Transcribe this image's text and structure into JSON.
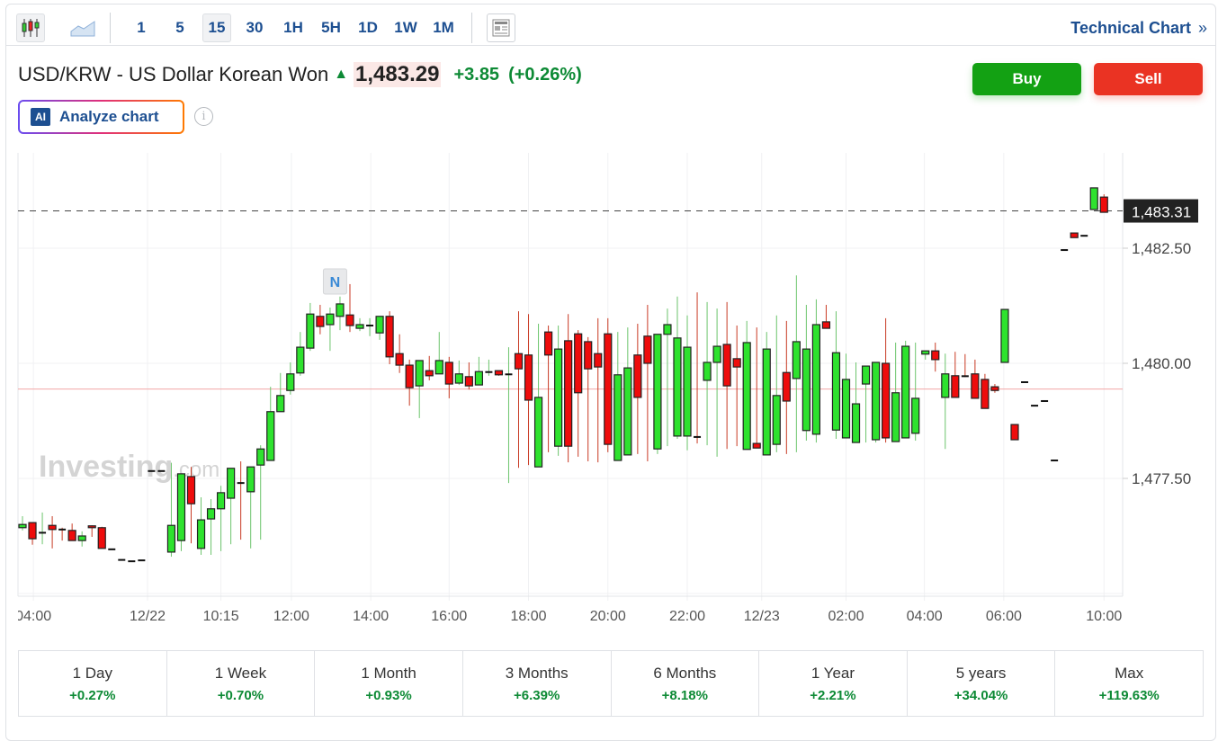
{
  "toolbar": {
    "intervals": [
      "1",
      "5",
      "15",
      "30",
      "1H",
      "5H",
      "1D",
      "1W",
      "1M"
    ],
    "active_interval": "15",
    "technical_chart": "Technical Chart",
    "technical_chart_icon": "double-chevron-right-icon"
  },
  "header": {
    "title": "USD/KRW - US Dollar Korean Won",
    "price": "1,483.29",
    "change": "+3.85",
    "change_pct": "(+0.26%)",
    "direction": "up"
  },
  "actions": {
    "buy": "Buy",
    "sell": "Sell",
    "analyze": "Analyze chart",
    "ai_badge": "AI"
  },
  "colors": {
    "up": "#2ee22e",
    "down": "#ee0c0c",
    "buy": "#13a113",
    "sell": "#ea3323",
    "link": "#1d4f91",
    "positive": "#0d8a35"
  },
  "watermark": {
    "brand": "Investing",
    "suffix": ".com"
  },
  "chart_data": {
    "type": "candlestick",
    "current_price_label": "1,483.31",
    "current_price": 1483.31,
    "reference_line": 1479.44,
    "ylim": [
      1474.96,
      1484.57
    ],
    "yticks": [
      {
        "v": 1482.5,
        "label": "1,482.50"
      },
      {
        "v": 1480.0,
        "label": "1,480.00"
      },
      {
        "v": 1477.5,
        "label": "1,477.50"
      }
    ],
    "ygrid": [
      1475,
      1477.5,
      1480,
      1482.5
    ],
    "xticks": [
      {
        "i": 1.1,
        "label": "04:00"
      },
      {
        "i": 12.6,
        "label": "12/22"
      },
      {
        "i": 20.0,
        "label": "10:15"
      },
      {
        "i": 27.1,
        "label": "12:00"
      },
      {
        "i": 35.1,
        "label": "14:00"
      },
      {
        "i": 43.0,
        "label": "16:00"
      },
      {
        "i": 51.0,
        "label": "18:00"
      },
      {
        "i": 59.0,
        "label": "20:00"
      },
      {
        "i": 67.0,
        "label": "22:00"
      },
      {
        "i": 74.5,
        "label": "12/23"
      },
      {
        "i": 83.0,
        "label": "02:00"
      },
      {
        "i": 90.9,
        "label": "04:00"
      },
      {
        "i": 98.9,
        "label": "06:00"
      },
      {
        "i": 109.0,
        "label": "10:00"
      }
    ],
    "news_marker": {
      "i": 31.5,
      "label": "N"
    },
    "candles_ohlc": [
      [
        1476.43,
        1476.68,
        1476.37,
        1476.5
      ],
      [
        1476.54,
        1476.54,
        1476.06,
        1476.19
      ],
      [
        1476.31,
        1476.76,
        1476.07,
        1476.32
      ],
      [
        1476.48,
        1476.68,
        1475.98,
        1476.39
      ],
      [
        1476.39,
        1476.43,
        1476.15,
        1476.38
      ],
      [
        1476.37,
        1476.52,
        1476.15,
        1476.15
      ],
      [
        1476.15,
        1476.35,
        1476.02,
        1476.25
      ],
      [
        1476.47,
        1476.48,
        1476.23,
        1476.43
      ],
      [
        1476.43,
        1476.45,
        1475.98,
        1475.98
      ],
      [
        1475.96,
        1475.96,
        1475.96,
        1475.95
      ],
      [
        1475.72,
        1475.72,
        1475.72,
        1475.73
      ],
      [
        1475.7,
        1475.7,
        1475.7,
        1475.7
      ],
      [
        1475.72,
        1475.72,
        1475.72,
        1475.72
      ],
      [
        1477.66,
        1477.66,
        1477.66,
        1477.66
      ],
      [
        1477.66,
        1477.66,
        1477.66,
        1477.66
      ],
      [
        1475.9,
        1477.84,
        1475.8,
        1476.48
      ],
      [
        1476.15,
        1477.6,
        1475.92,
        1477.6
      ],
      [
        1477.54,
        1477.75,
        1476.09,
        1476.95
      ],
      [
        1475.98,
        1477.09,
        1475.84,
        1476.6
      ],
      [
        1476.62,
        1477.05,
        1475.84,
        1476.84
      ],
      [
        1476.84,
        1477.34,
        1475.92,
        1477.19
      ],
      [
        1477.07,
        1477.72,
        1476.07,
        1477.72
      ],
      [
        1477.4,
        1477.87,
        1476.17,
        1477.39
      ],
      [
        1477.21,
        1477.75,
        1475.98,
        1477.75
      ],
      [
        1477.79,
        1478.22,
        1476.17,
        1478.14
      ],
      [
        1477.89,
        1479.49,
        1477.89,
        1478.95
      ],
      [
        1478.95,
        1479.79,
        1478.95,
        1479.3
      ],
      [
        1479.41,
        1480.02,
        1479.32,
        1479.77
      ],
      [
        1479.79,
        1480.68,
        1479.73,
        1480.35
      ],
      [
        1480.33,
        1481.31,
        1480.27,
        1481.07
      ],
      [
        1481.02,
        1481.27,
        1480.63,
        1480.8
      ],
      [
        1480.84,
        1481.21,
        1480.27,
        1481.07
      ],
      [
        1481.02,
        1481.45,
        1480.72,
        1481.29
      ],
      [
        1481.05,
        1481.72,
        1480.68,
        1480.82
      ],
      [
        1480.76,
        1480.98,
        1480.7,
        1480.84
      ],
      [
        1480.82,
        1480.98,
        1480.59,
        1480.82
      ],
      [
        1480.66,
        1481.02,
        1480.51,
        1481.02
      ],
      [
        1481.02,
        1481.13,
        1479.98,
        1480.14
      ],
      [
        1480.21,
        1480.63,
        1479.79,
        1479.96
      ],
      [
        1479.96,
        1480.08,
        1479.08,
        1479.47
      ],
      [
        1479.51,
        1480.06,
        1478.81,
        1480.06
      ],
      [
        1479.84,
        1480.16,
        1479.63,
        1479.73
      ],
      [
        1479.77,
        1480.68,
        1479.77,
        1480.06
      ],
      [
        1480.02,
        1480.14,
        1479.24,
        1479.55
      ],
      [
        1479.57,
        1480.06,
        1479.53,
        1479.77
      ],
      [
        1479.71,
        1480.02,
        1479.43,
        1479.51
      ],
      [
        1479.53,
        1480.14,
        1479.53,
        1479.82
      ],
      [
        1479.8,
        1480.08,
        1479.73,
        1479.81
      ],
      [
        1479.84,
        1479.84,
        1479.73,
        1479.75
      ],
      [
        1479.75,
        1480.35,
        1477.4,
        1479.76
      ],
      [
        1480.21,
        1481.13,
        1477.73,
        1479.88
      ],
      [
        1480.18,
        1481.07,
        1477.79,
        1479.2
      ],
      [
        1477.75,
        1480.86,
        1477.75,
        1479.26
      ],
      [
        1480.68,
        1480.82,
        1478.07,
        1480.18
      ],
      [
        1478.2,
        1480.82,
        1477.99,
        1480.31
      ],
      [
        1480.49,
        1481.07,
        1477.85,
        1478.2
      ],
      [
        1480.64,
        1480.72,
        1477.97,
        1479.36
      ],
      [
        1480.47,
        1480.57,
        1477.87,
        1479.88
      ],
      [
        1480.21,
        1480.98,
        1477.85,
        1479.92
      ],
      [
        1480.64,
        1480.98,
        1478.07,
        1478.24
      ],
      [
        1477.89,
        1480.68,
        1477.89,
        1479.75
      ],
      [
        1478.01,
        1480.78,
        1478.01,
        1479.9
      ],
      [
        1480.18,
        1480.86,
        1478.03,
        1479.26
      ],
      [
        1480.59,
        1481.27,
        1477.87,
        1480.0
      ],
      [
        1478.14,
        1480.63,
        1478.03,
        1480.63
      ],
      [
        1480.63,
        1481.19,
        1478.2,
        1480.84
      ],
      [
        1478.42,
        1481.45,
        1478.36,
        1480.55
      ],
      [
        1478.42,
        1481.04,
        1478.11,
        1480.35
      ],
      [
        1478.4,
        1481.54,
        1478.26,
        1478.38
      ],
      [
        1479.63,
        1481.33,
        1478.22,
        1480.02
      ],
      [
        1480.02,
        1481.19,
        1477.97,
        1480.37
      ],
      [
        1480.41,
        1481.33,
        1478.14,
        1479.51
      ],
      [
        1480.1,
        1480.82,
        1478.2,
        1479.92
      ],
      [
        1478.13,
        1480.92,
        1478.13,
        1480.45
      ],
      [
        1478.26,
        1480.78,
        1478.16,
        1478.16
      ],
      [
        1478.01,
        1480.68,
        1478.01,
        1480.31
      ],
      [
        1478.24,
        1481.04,
        1478.07,
        1479.3
      ],
      [
        1479.8,
        1480.92,
        1478.03,
        1479.18
      ],
      [
        1479.67,
        1481.91,
        1478.07,
        1480.47
      ],
      [
        1478.54,
        1481.27,
        1478.32,
        1480.31
      ],
      [
        1478.46,
        1481.39,
        1478.28,
        1480.84
      ],
      [
        1480.9,
        1481.27,
        1480.76,
        1480.76
      ],
      [
        1478.55,
        1481.13,
        1478.36,
        1480.23
      ],
      [
        1478.38,
        1480.21,
        1478.38,
        1479.65
      ],
      [
        1478.28,
        1480.02,
        1478.28,
        1479.12
      ],
      [
        1479.55,
        1479.94,
        1478.28,
        1479.94
      ],
      [
        1478.34,
        1480.02,
        1478.28,
        1480.02
      ],
      [
        1480.0,
        1480.98,
        1478.28,
        1478.38
      ],
      [
        1478.3,
        1480.45,
        1478.3,
        1479.36
      ],
      [
        1478.38,
        1480.49,
        1478.38,
        1480.37
      ],
      [
        1478.48,
        1480.45,
        1478.32,
        1479.24
      ],
      [
        1480.2,
        1480.27,
        1480.08,
        1480.27
      ],
      [
        1480.27,
        1480.45,
        1479.82,
        1480.08
      ],
      [
        1479.26,
        1480.21,
        1478.14,
        1479.77
      ],
      [
        1479.73,
        1480.25,
        1479.26,
        1479.26
      ],
      [
        1479.72,
        1480.2,
        1479.7,
        1479.71
      ],
      [
        1479.77,
        1480.08,
        1479.24,
        1479.24
      ],
      [
        1479.65,
        1479.77,
        1479.02,
        1479.02
      ],
      [
        1479.49,
        1479.55,
        1479.36,
        1479.41
      ],
      [
        1480.02,
        1481.17,
        1480.02,
        1481.17
      ],
      [
        1478.67,
        1478.67,
        1478.34,
        1478.34
      ],
      [
        1479.59,
        1479.59,
        1479.59,
        1479.59
      ],
      [
        1479.08,
        1479.08,
        1479.08,
        1479.08
      ],
      [
        1479.18,
        1479.18,
        1479.18,
        1479.18
      ],
      [
        1477.89,
        1477.89,
        1477.89,
        1477.89
      ],
      [
        1482.46,
        1482.46,
        1482.46,
        1482.46
      ],
      [
        1482.83,
        1482.83,
        1482.73,
        1482.73
      ],
      [
        1482.77,
        1482.77,
        1482.77,
        1482.77
      ],
      [
        1483.34,
        1483.81,
        1483.34,
        1483.81
      ],
      [
        1483.61,
        1483.67,
        1483.28,
        1483.28
      ]
    ]
  },
  "periods": [
    {
      "label": "1 Day",
      "value": "+0.27%"
    },
    {
      "label": "1 Week",
      "value": "+0.70%"
    },
    {
      "label": "1 Month",
      "value": "+0.93%"
    },
    {
      "label": "3 Months",
      "value": "+6.39%"
    },
    {
      "label": "6 Months",
      "value": "+8.18%"
    },
    {
      "label": "1 Year",
      "value": "+2.21%"
    },
    {
      "label": "5 years",
      "value": "+34.04%"
    },
    {
      "label": "Max",
      "value": "+119.63%"
    }
  ]
}
